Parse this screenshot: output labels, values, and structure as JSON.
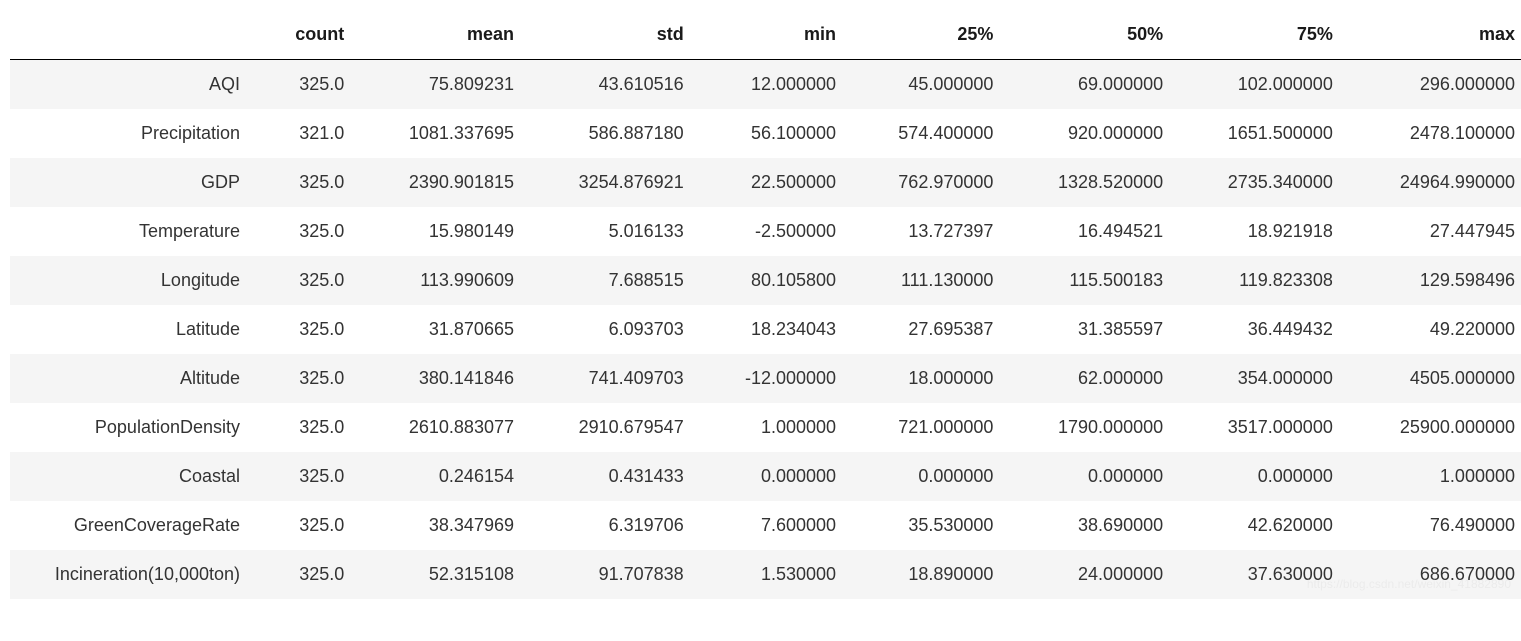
{
  "table": {
    "columns": [
      "count",
      "mean",
      "std",
      "min",
      "25%",
      "50%",
      "75%",
      "max"
    ],
    "rows": [
      {
        "label": "AQI",
        "values": [
          "325.0",
          "75.809231",
          "43.610516",
          "12.000000",
          "45.000000",
          "69.000000",
          "102.000000",
          "296.000000"
        ]
      },
      {
        "label": "Precipitation",
        "values": [
          "321.0",
          "1081.337695",
          "586.887180",
          "56.100000",
          "574.400000",
          "920.000000",
          "1651.500000",
          "2478.100000"
        ]
      },
      {
        "label": "GDP",
        "values": [
          "325.0",
          "2390.901815",
          "3254.876921",
          "22.500000",
          "762.970000",
          "1328.520000",
          "2735.340000",
          "24964.990000"
        ]
      },
      {
        "label": "Temperature",
        "values": [
          "325.0",
          "15.980149",
          "5.016133",
          "-2.500000",
          "13.727397",
          "16.494521",
          "18.921918",
          "27.447945"
        ]
      },
      {
        "label": "Longitude",
        "values": [
          "325.0",
          "113.990609",
          "7.688515",
          "80.105800",
          "111.130000",
          "115.500183",
          "119.823308",
          "129.598496"
        ]
      },
      {
        "label": "Latitude",
        "values": [
          "325.0",
          "31.870665",
          "6.093703",
          "18.234043",
          "27.695387",
          "31.385597",
          "36.449432",
          "49.220000"
        ]
      },
      {
        "label": "Altitude",
        "values": [
          "325.0",
          "380.141846",
          "741.409703",
          "-12.000000",
          "18.000000",
          "62.000000",
          "354.000000",
          "4505.000000"
        ]
      },
      {
        "label": "PopulationDensity",
        "values": [
          "325.0",
          "2610.883077",
          "2910.679547",
          "1.000000",
          "721.000000",
          "1790.000000",
          "3517.000000",
          "25900.000000"
        ]
      },
      {
        "label": "Coastal",
        "values": [
          "325.0",
          "0.246154",
          "0.431433",
          "0.000000",
          "0.000000",
          "0.000000",
          "0.000000",
          "1.000000"
        ]
      },
      {
        "label": "GreenCoverageRate",
        "values": [
          "325.0",
          "38.347969",
          "6.319706",
          "7.600000",
          "35.530000",
          "38.690000",
          "42.620000",
          "76.490000"
        ]
      },
      {
        "label": "Incineration(10,000ton)",
        "values": [
          "325.0",
          "52.315108",
          "91.707838",
          "1.530000",
          "18.890000",
          "24.000000",
          "37.630000",
          "686.670000"
        ]
      }
    ]
  },
  "watermark": "https://blog.csdn.net/weixin_41882890"
}
